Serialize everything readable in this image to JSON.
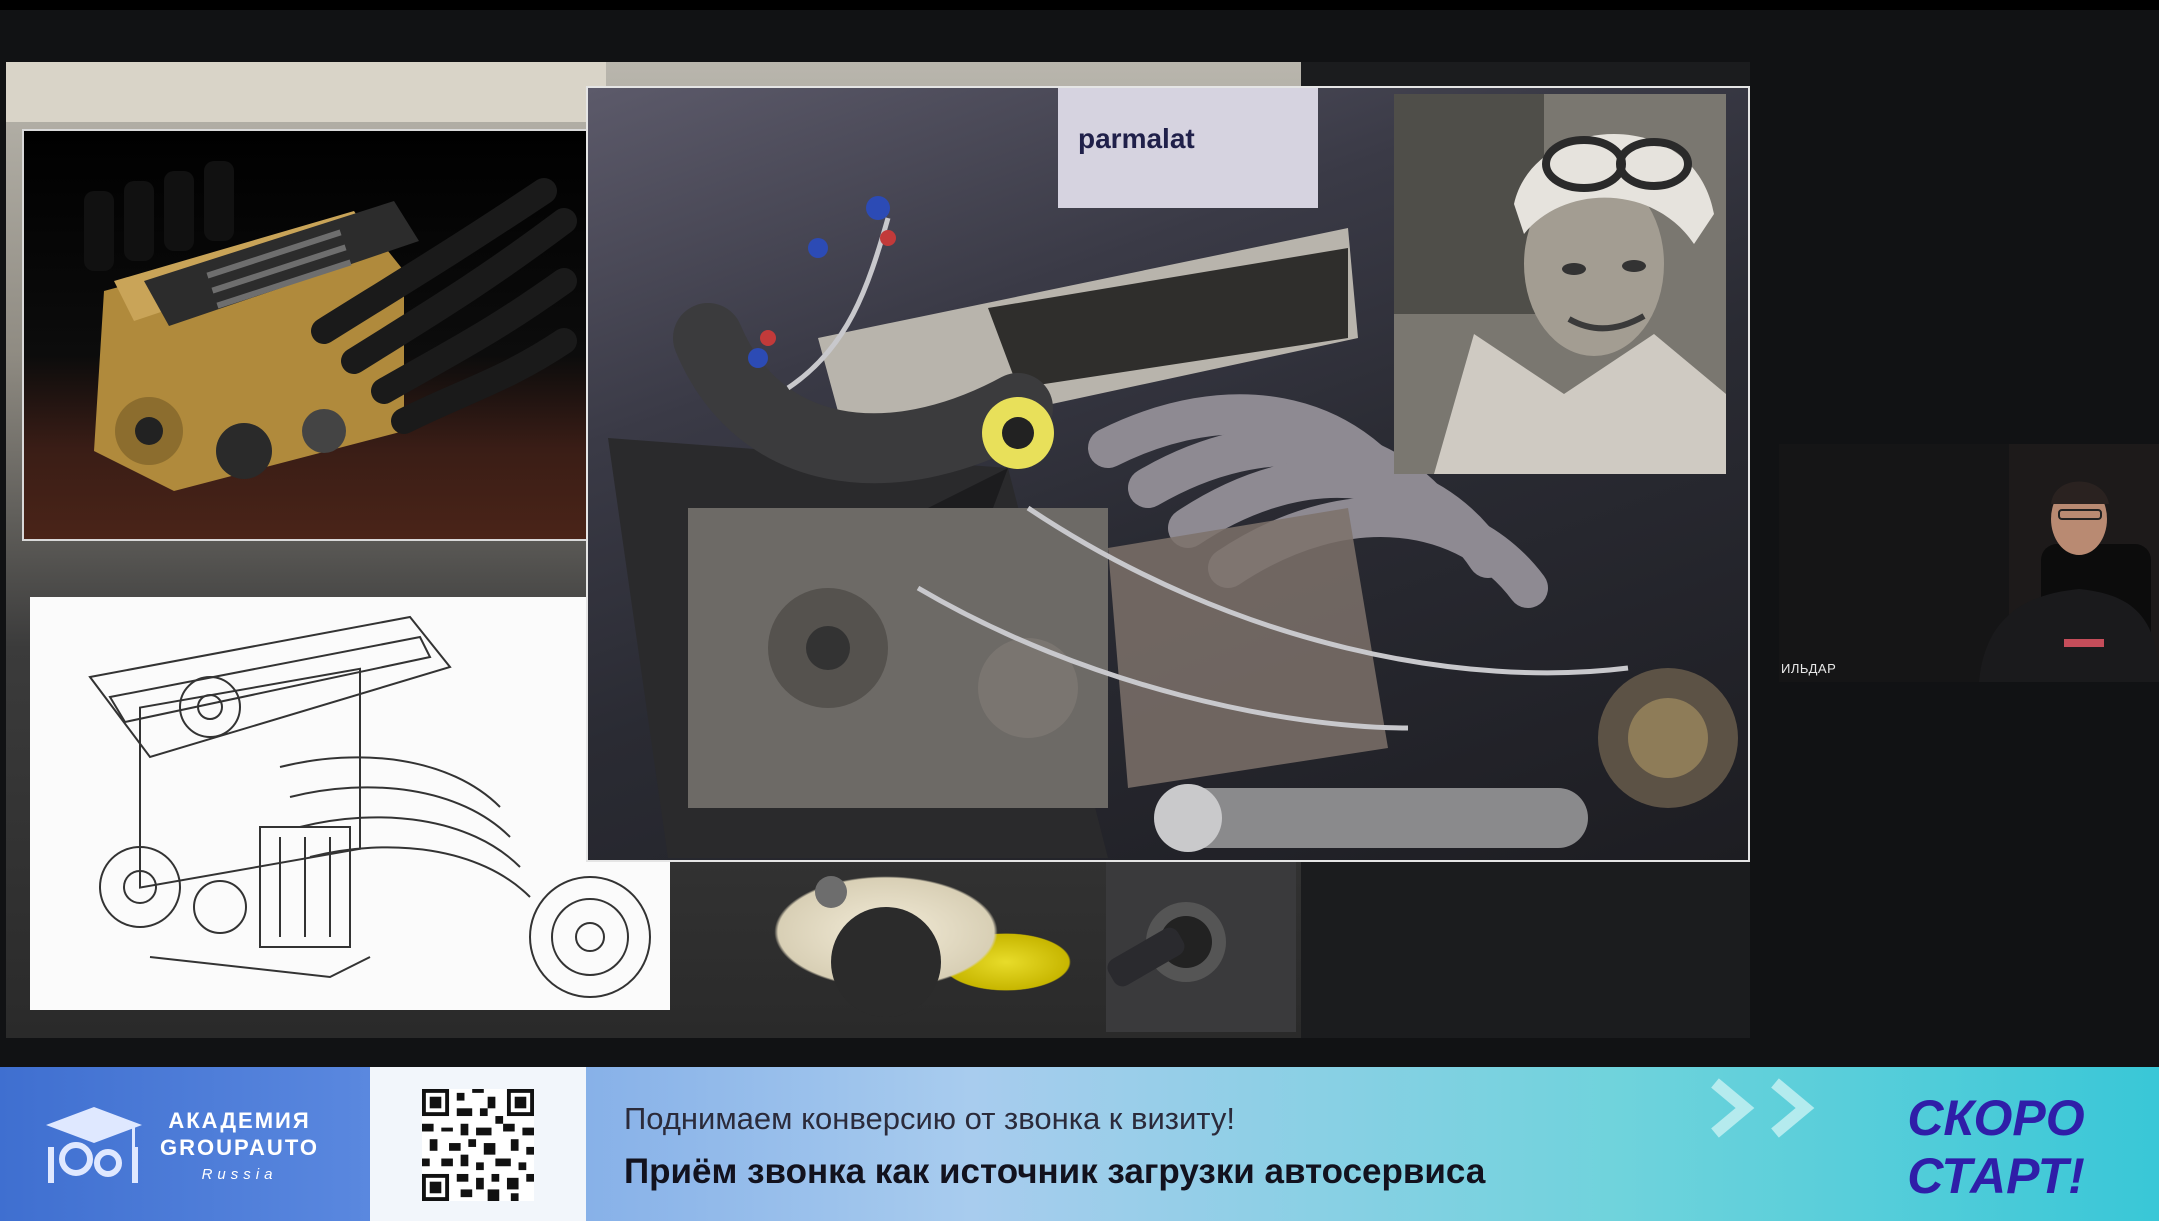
{
  "webcam": {
    "speaker_name": "ИЛЬДАР"
  },
  "slide": {
    "photo_text": "parmalat"
  },
  "banner": {
    "logo": {
      "line1": "АКАДЕМИЯ",
      "line2": "GROUPAUTO",
      "line3": "Russia"
    },
    "subtitle": "Поднимаем конверсию от звонка к визиту!",
    "title": "Приём звонка как источник загрузки автосервиса",
    "cta_line1": "СКОРО",
    "cta_line2": "СТАРТ!"
  },
  "icons": {
    "logo": "graduation-cap-gears-icon",
    "qr": "qr-code-icon",
    "chevrons": "double-chevron-right-icon"
  },
  "colors": {
    "banner_left": "#4a78d6",
    "banner_right": "#39c7d7",
    "cta": "#2f1ea8",
    "background": "#111214"
  }
}
